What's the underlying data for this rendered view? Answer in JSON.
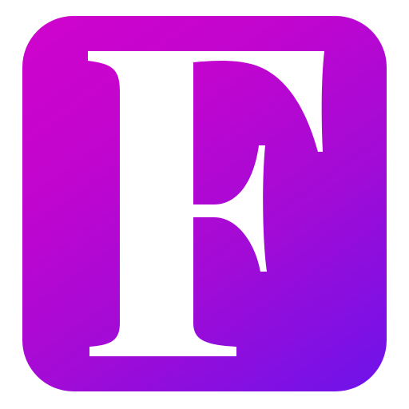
{
  "app_icon": {
    "letter": "F",
    "colors": {
      "gradient_start": "#cf04cc",
      "gradient_mid": "#a20bd6",
      "gradient_end": "#6d13ea",
      "letter_fill": "#ffffff",
      "background": "#ffffff"
    }
  }
}
